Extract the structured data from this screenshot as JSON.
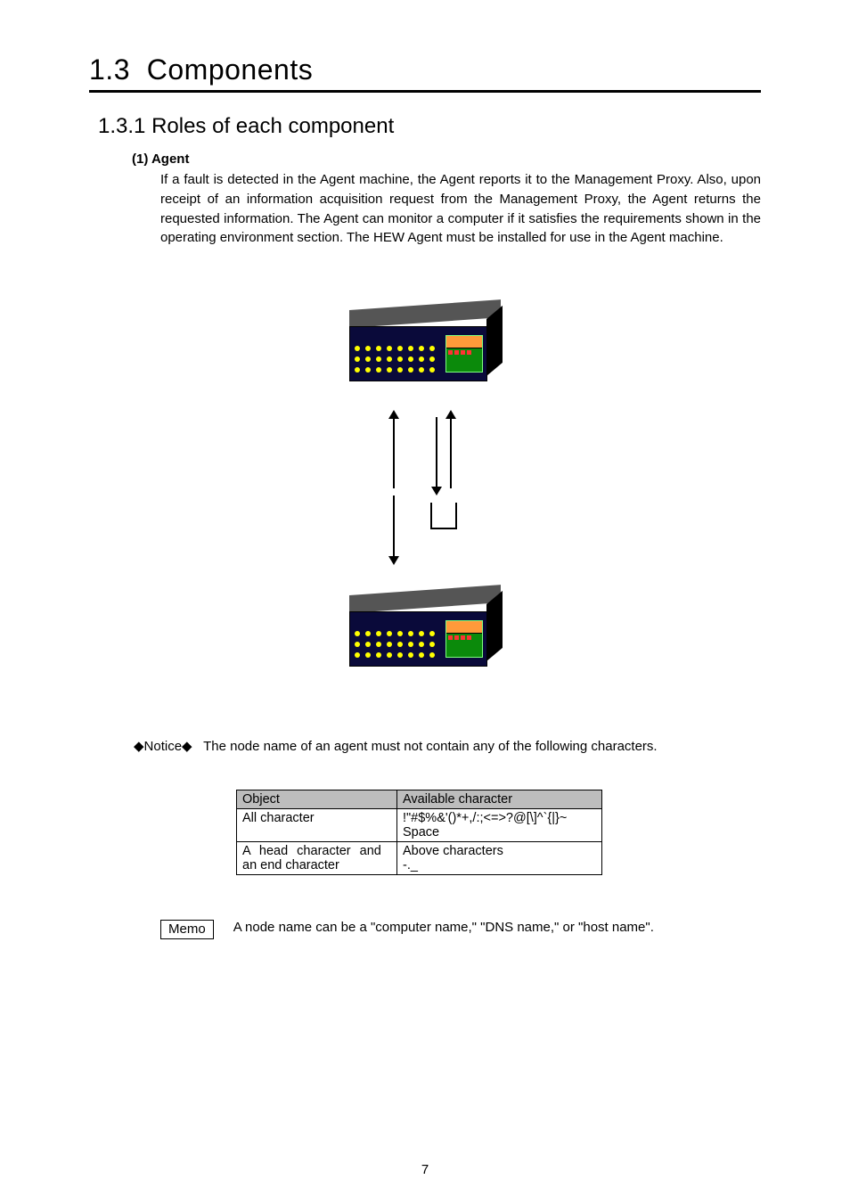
{
  "section_number": "1.3",
  "section_title": "Components",
  "subsection_number": "1.3.1",
  "subsection_title": "Roles of each component",
  "subheading": "(1) Agent",
  "body_paragraph": "If a fault is detected in the Agent machine, the Agent reports it to the Management Proxy. Also, upon receipt of an information acquisition request from the Management Proxy, the Agent returns the requested information. The Agent can monitor a computer if it satisfies the requirements shown in the operating environment section. The HEW Agent must be installed for use in the Agent machine.",
  "notice_label": "◆Notice◆",
  "notice_text": "The node name of an agent must not contain any of the following characters.",
  "table": {
    "header": {
      "col1": "Object",
      "col2": "Available character"
    },
    "rows": [
      {
        "col1": "All character",
        "col2_line1": "!\"#$%&'()*+,/:;<=>?@[\\]^`{|}~",
        "col2_line2": "Space"
      },
      {
        "col1_line1": "A head character and",
        "col1_line2": "an end character",
        "col2_line1": "Above characters",
        "col2_line2": "-._"
      }
    ]
  },
  "memo_label": "Memo",
  "memo_text": "A node name can be a \"computer name,\" \"DNS name,\" or \"host name\".",
  "page_number": "7"
}
